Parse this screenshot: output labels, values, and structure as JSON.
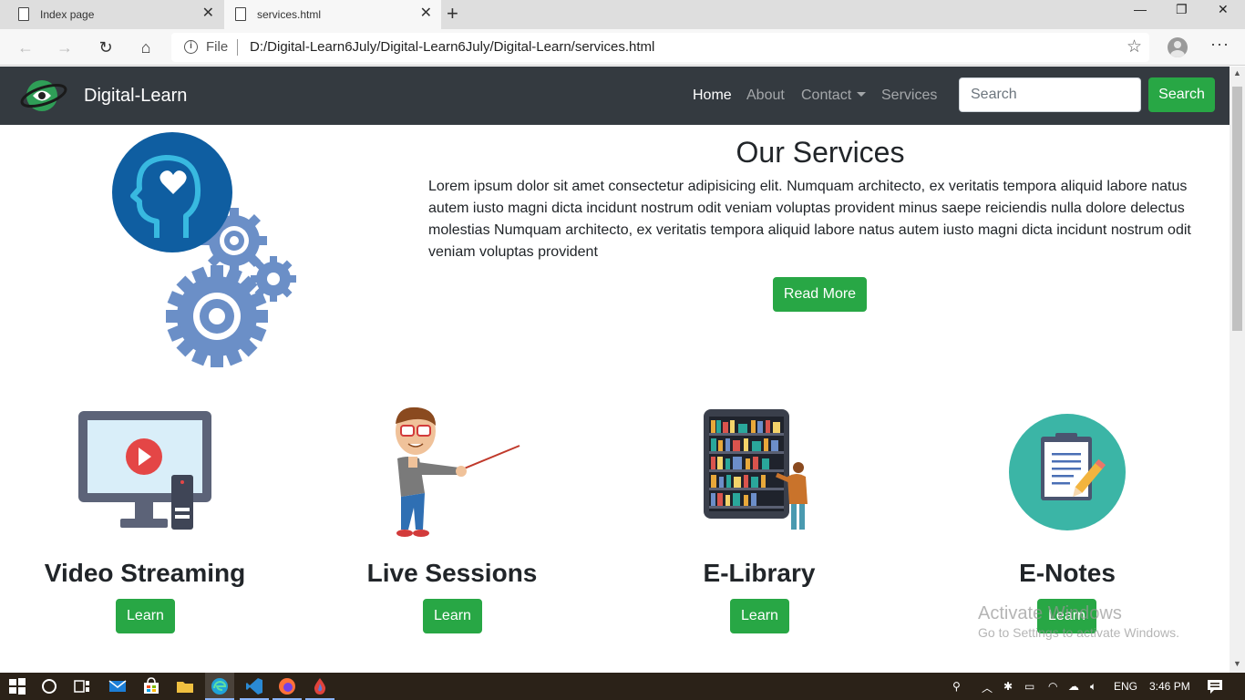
{
  "browser": {
    "tabs": [
      {
        "label": "Index page"
      },
      {
        "label": "services.html"
      }
    ],
    "address": {
      "scheme_label": "File",
      "url": "D:/Digital-Learn6July/Digital-Learn6July/Digital-Learn/services.html"
    }
  },
  "navbar": {
    "brand": "Digital-Learn",
    "links": [
      {
        "label": "Home"
      },
      {
        "label": "About"
      },
      {
        "label": "Contact"
      },
      {
        "label": "Services"
      }
    ],
    "search_placeholder": "Search",
    "search_button": "Search"
  },
  "hero": {
    "title": "Our Services",
    "text": "Lorem ipsum dolor sit amet consectetur adipisicing elit. Numquam architecto, ex veritatis tempora aliquid labore natus autem iusto magni dicta incidunt nostrum odit veniam voluptas provident minus saepe reiciendis nulla dolore delectus molestias Numquam architecto, ex veritatis tempora aliquid labore natus autem iusto magni dicta incidunt nostrum odit veniam voluptas provident",
    "button": "Read More"
  },
  "services": [
    {
      "title": "Video Streaming",
      "button": "Learn"
    },
    {
      "title": "Live Sessions",
      "button": "Learn"
    },
    {
      "title": "E-Library",
      "button": "Learn"
    },
    {
      "title": "E-Notes",
      "button": "Learn"
    }
  ],
  "watermark": {
    "line1": "Activate Windows",
    "line2": "Go to Settings to activate Windows."
  },
  "taskbar": {
    "lang": "ENG",
    "time": "3:46 PM"
  },
  "colors": {
    "navbar": "#343a40",
    "success": "#28a745",
    "taskbar": "#2b2218"
  }
}
